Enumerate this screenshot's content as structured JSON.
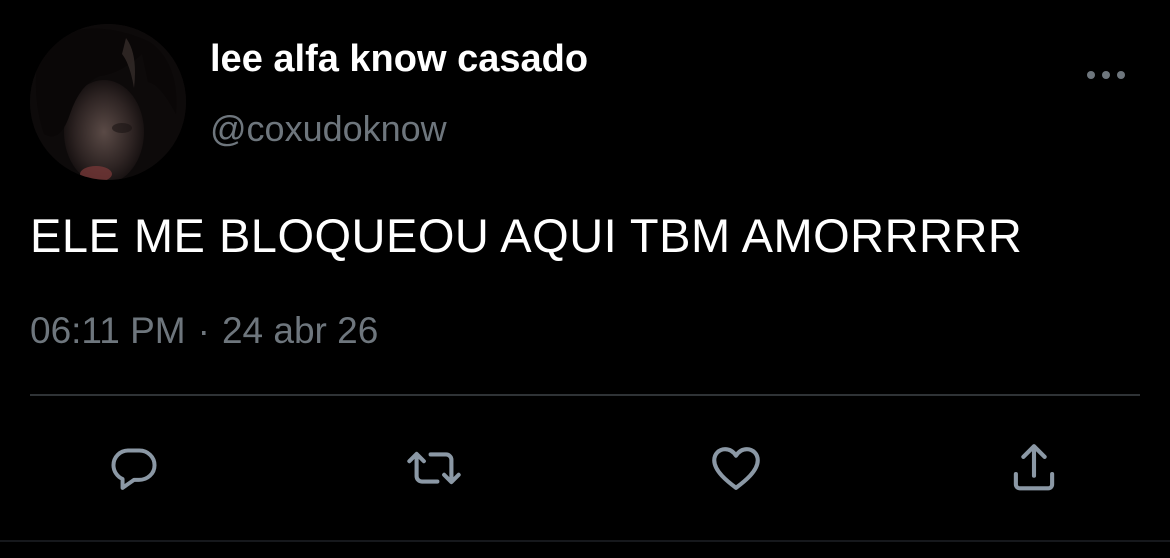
{
  "tweet": {
    "display_name": "lee alfa know casado",
    "handle": "@coxudoknow",
    "text": "ELE ME BLOQUEOU AQUI TBM AMORRRRR",
    "time": "06:11 PM",
    "separator": "·",
    "date": "24 abr 26"
  },
  "icons": {
    "more": "more-horizontal-icon",
    "reply": "reply-icon",
    "retweet": "retweet-icon",
    "like": "heart-icon",
    "share": "share-icon"
  },
  "colors": {
    "background": "#000000",
    "primary_text": "#ffffff",
    "secondary_text": "#6e767d",
    "divider": "#2f3336",
    "icon": "#8b98a5"
  }
}
